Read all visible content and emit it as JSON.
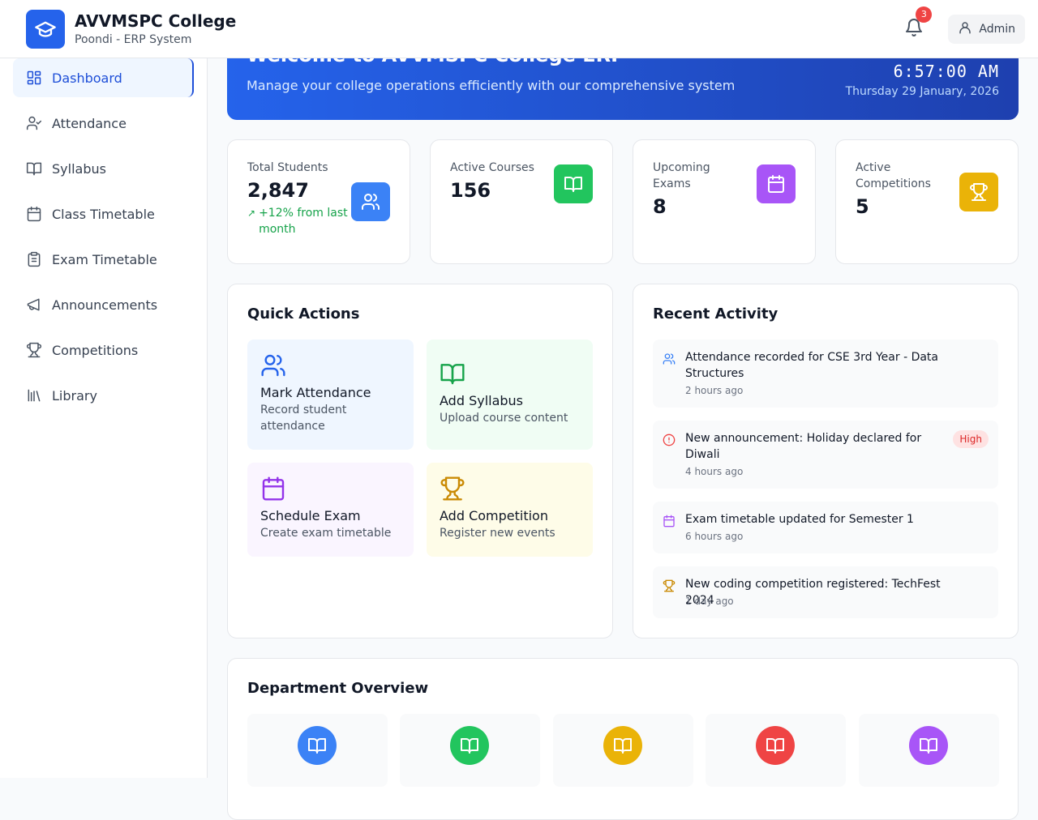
{
  "header": {
    "title": "AVVMSPC College",
    "subtitle": "Poondi - ERP System",
    "notification_count": "3",
    "user_label": "Admin"
  },
  "sidebar": {
    "items": [
      {
        "label": "Dashboard",
        "icon": "dashboard-icon",
        "active": true
      },
      {
        "label": "Attendance",
        "icon": "user-check-icon"
      },
      {
        "label": "Syllabus",
        "icon": "book-icon"
      },
      {
        "label": "Class Timetable",
        "icon": "calendar-icon"
      },
      {
        "label": "Exam Timetable",
        "icon": "clipboard-icon"
      },
      {
        "label": "Announcements",
        "icon": "megaphone-icon"
      },
      {
        "label": "Competitions",
        "icon": "trophy-icon"
      },
      {
        "label": "Library",
        "icon": "library-icon"
      }
    ]
  },
  "hero": {
    "title": "Welcome to AVVMSPC College ERP",
    "description": "Manage your college operations efficiently with our comprehensive system",
    "time": "6:57:00 AM",
    "date": "Thursday 29 January, 2026"
  },
  "stats": [
    {
      "label": "Total Students",
      "value": "2,847",
      "trend": "+12% from last month",
      "icon": "users-icon",
      "color": "#3b82f6"
    },
    {
      "label": "Active Courses",
      "value": "156",
      "icon": "book-icon",
      "color": "#22c55e"
    },
    {
      "label": "Upcoming Exams",
      "value": "8",
      "icon": "calendar-icon",
      "color": "#a855f7"
    },
    {
      "label": "Active Competitions",
      "value": "5",
      "icon": "trophy-icon",
      "color": "#eab308"
    }
  ],
  "quick_actions": {
    "title": "Quick Actions",
    "items": [
      {
        "title": "Mark Attendance",
        "desc": "Record student attendance",
        "icon": "users-icon",
        "color": "#2563eb",
        "bg": "#eff6ff"
      },
      {
        "title": "Add Syllabus",
        "desc": "Upload course content",
        "icon": "book-icon",
        "color": "#16a34a",
        "bg": "#f0fdf4"
      },
      {
        "title": "Schedule Exam",
        "desc": "Create exam timetable",
        "icon": "calendar-icon",
        "color": "#9333ea",
        "bg": "#faf5ff"
      },
      {
        "title": "Add Competition",
        "desc": "Register new events",
        "icon": "trophy-icon",
        "color": "#ca8a04",
        "bg": "#fefce8"
      }
    ]
  },
  "recent_activity": {
    "title": "Recent Activity",
    "items": [
      {
        "text": "Attendance recorded for CSE 3rd Year - Data Structures",
        "time": "2 hours ago",
        "icon": "users-icon",
        "color": "#3b82f6"
      },
      {
        "text": "New announcement: Holiday declared for Diwali",
        "time": "4 hours ago",
        "icon": "alert-circle-icon",
        "color": "#ef4444",
        "badge": "High"
      },
      {
        "text": "Exam timetable updated for Semester 1",
        "time": "6 hours ago",
        "icon": "calendar-icon",
        "color": "#a855f7"
      },
      {
        "text": "New coding competition registered: TechFest 2024",
        "time": "1 day ago",
        "icon": "trophy-icon",
        "color": "#ca8a04"
      }
    ]
  },
  "department_overview": {
    "title": "Department Overview",
    "colors": [
      "#3b82f6",
      "#22c55e",
      "#eab308",
      "#ef4444",
      "#a855f7"
    ]
  }
}
